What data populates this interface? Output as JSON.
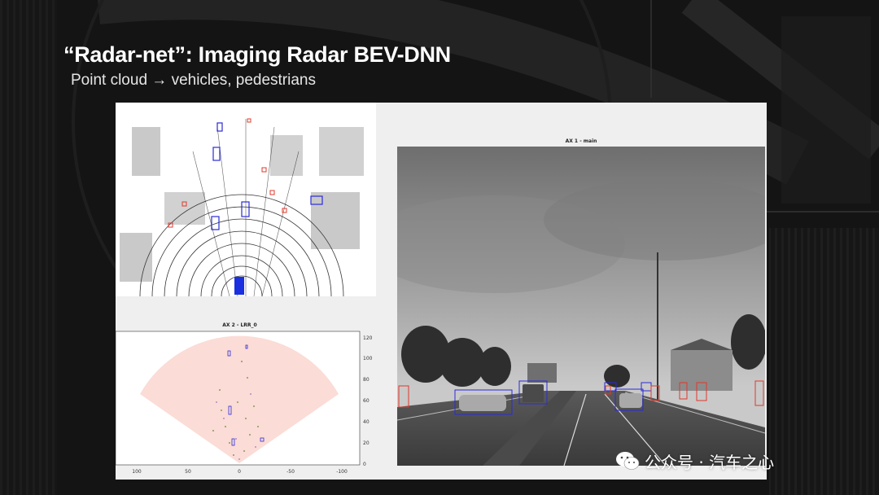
{
  "slide": {
    "title": "“Radar-net”: Imaging Radar BEV-DNN",
    "subtitle": "Point cloud → vehicles, pedestrians"
  },
  "figure": {
    "radar_view": {
      "title": "AX 2 - LRR_0",
      "y_ticks": [
        "120",
        "100",
        "80",
        "60",
        "40",
        "20",
        "0"
      ],
      "x_ticks": [
        "100",
        "50",
        "0",
        "-50",
        "-100"
      ]
    },
    "camera_view": {
      "title": "AX 1 - main"
    }
  },
  "watermark": {
    "text": "公众号 · 汽车之心",
    "icon": "wechat-icon"
  },
  "colors": {
    "background": "#141414",
    "vehicle_box": "#2b2bd6",
    "pedestrian_box": "#e0392b",
    "radar_fov": "#fbdcd6"
  }
}
